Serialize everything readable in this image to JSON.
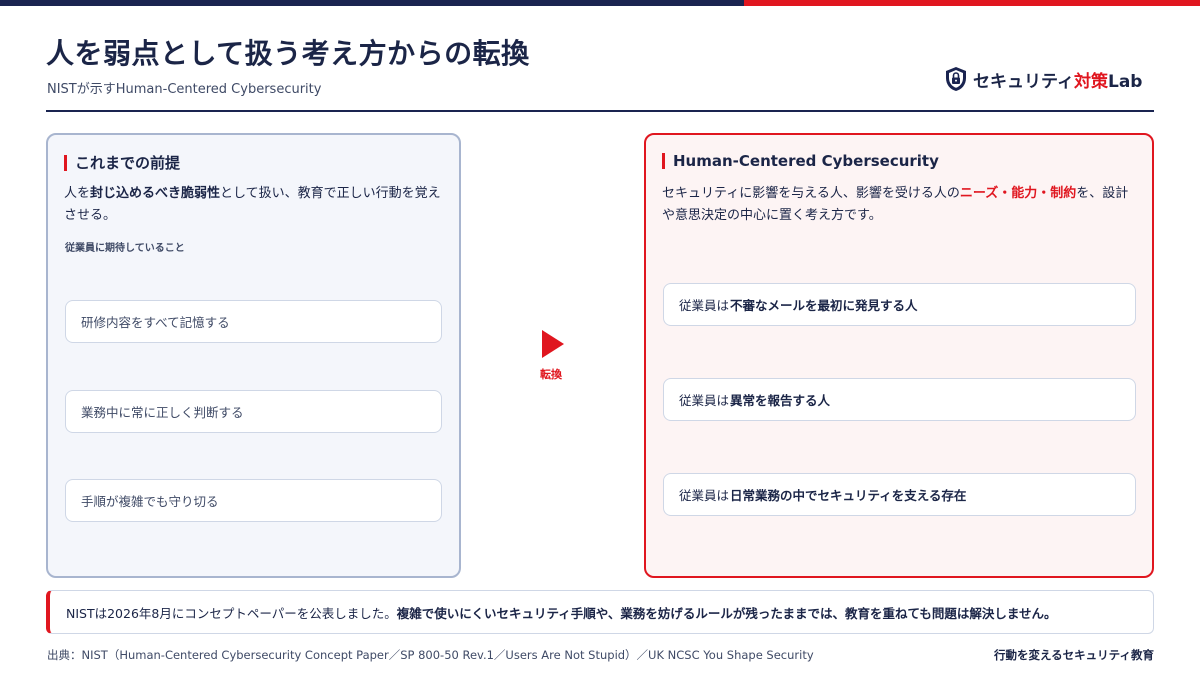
{
  "colors": {
    "navy": "#1a2450",
    "red": "#e0161f",
    "left_panel_bg": "#f4f6fb",
    "right_panel_bg": "#fdf4f4"
  },
  "header": {
    "title": "人を弱点として扱う考え方からの転換",
    "subtitle": "NISTが示すHuman-Centered Cybersecurity"
  },
  "logo": {
    "icon": "shield-lock-icon",
    "text_main": "セキュリティ",
    "text_accent": "対策",
    "text_tail": "Lab"
  },
  "left_panel": {
    "title": "これまでの前提",
    "desc_part1": "人を",
    "desc_bold": "封じ込めるべき脆弱性",
    "desc_part2": "として扱い、教育で正しい行動を覚えさせる。",
    "expect_label": "従業員に期待していること",
    "items": [
      "研修内容をすべて記憶する",
      "業務中に常に正しく判断する",
      "手順が複雑でも守り切る"
    ]
  },
  "transition": {
    "label": "転換",
    "icon": "play-arrow-icon"
  },
  "right_panel": {
    "title": "Human-Centered Cybersecurity",
    "desc_part1": "セキュリティに影響を与える人、影響を受ける人の",
    "desc_highlight": "ニーズ・能力・制約",
    "desc_part2": "を、設計や意思決定の中心に置く考え方です。",
    "items": [
      {
        "prefix": "従業員は",
        "bold": "不審なメールを最初に発見する人"
      },
      {
        "prefix": "従業員は",
        "bold": "異常を報告する人"
      },
      {
        "prefix": "従業員は",
        "bold": "日常業務の中でセキュリティを支える存在"
      }
    ]
  },
  "note": {
    "part1": "NISTは2026年8月にコンセプトペーパーを公表しました。",
    "bold": "複雑で使いにくいセキュリティ手順や、業務を妨げるルールが残ったままでは、教育を重ねても問題は解決しません。"
  },
  "footer": {
    "source": "出典：NIST（Human-Centered Cybersecurity Concept Paper／SP 800-50 Rev.1／Users Are Not Stupid）／UK NCSC You Shape Security",
    "right": "行動を変えるセキュリティ教育"
  }
}
